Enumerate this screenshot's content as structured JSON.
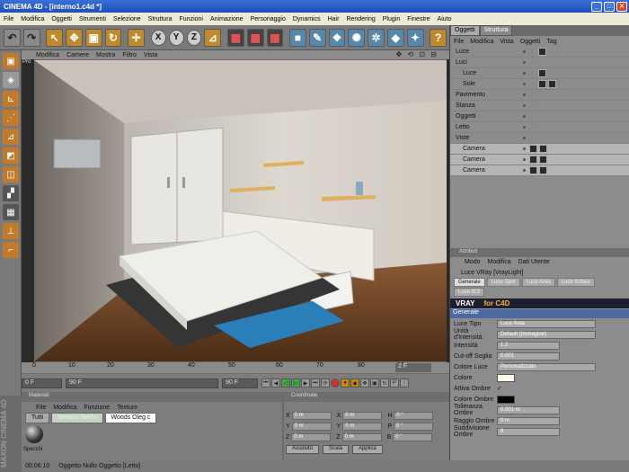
{
  "window": {
    "title": "CINEMA 4D - [interno1.c4d *]"
  },
  "menu": [
    "File",
    "Modifica",
    "Oggetti",
    "Strumenti",
    "Selezione",
    "Struttura",
    "Funzioni",
    "Animazione",
    "Personaggio",
    "Dynamics",
    "Hair",
    "Rendering",
    "Plugin",
    "Finestre",
    "Aiuto"
  ],
  "viewport": {
    "menu": [
      "Modifica",
      "Camere",
      "Mostra",
      "Filtro",
      "Vista"
    ],
    "label": "Pro",
    "nav": "✥ ⟲ ⊡ ⊟"
  },
  "timeline": {
    "ticks": [
      "0",
      "10",
      "20",
      "30",
      "40",
      "50",
      "60",
      "70",
      "80",
      "90"
    ],
    "frame": "2 F"
  },
  "playback": {
    "start": "0 F",
    "end": "90 F",
    "cur": "90 F"
  },
  "materials": {
    "header": "Materiali",
    "menu": [
      "File",
      "Modifica",
      "Funzione",
      "Texture"
    ],
    "tabs": [
      "Tutti",
      "Nessun livello",
      "Woods Oleg c"
    ],
    "item": "Specchi"
  },
  "coords": {
    "header": "Coordinate",
    "rows": [
      [
        "X",
        "0 m",
        "X",
        "0 m",
        "H",
        "0 °"
      ],
      [
        "Y",
        "0 m",
        "Y",
        "0 m",
        "P",
        "0 °"
      ],
      [
        "Z",
        "0 m",
        "Z",
        "0 m",
        "B",
        "0 °"
      ]
    ],
    "buttons": [
      "Assoluto",
      "Scala",
      "Applica"
    ]
  },
  "status": {
    "time": "00:06:10",
    "text": "Oggetto Nullo Oggetto [Letto]"
  },
  "maxon": "MAXON CINEMA 4D",
  "objects": {
    "tabs": [
      "Oggetti",
      "Struttura"
    ],
    "menu": [
      "File",
      "Modifica",
      "Vista",
      "Oggetti",
      "Tag"
    ],
    "items": [
      {
        "name": "Luce",
        "indent": 0
      },
      {
        "name": "Luci",
        "indent": 0
      },
      {
        "name": "Luce",
        "indent": 1
      },
      {
        "name": "Sole",
        "indent": 1
      },
      {
        "name": "Pavimento",
        "indent": 0
      },
      {
        "name": "Stanza",
        "indent": 0
      },
      {
        "name": "Oggetti",
        "indent": 0
      },
      {
        "name": "Letto",
        "indent": 0
      },
      {
        "name": "Viste",
        "indent": 0
      },
      {
        "name": "Camera",
        "indent": 1
      },
      {
        "name": "Camera",
        "indent": 1
      },
      {
        "name": "Camera",
        "indent": 1
      }
    ]
  },
  "attributes": {
    "header": "Attributi",
    "menu": [
      "Modo",
      "Modifica",
      "Dati Utente"
    ],
    "title": "Luce VRay [VrayLight]",
    "tabs": [
      "Generale",
      "Luce Spot",
      "Luce Area",
      "Luce Solare",
      "Luce IES"
    ],
    "vray": "VRAY",
    "vray2": "for C4D",
    "section": "Generale",
    "rows": [
      {
        "label": "Luce Tipo",
        "value": "Luce Area"
      },
      {
        "label": "Unità d'Intensità",
        "value": "Default (Immagine)"
      },
      {
        "label": "Intensità",
        "value": "1.2"
      },
      {
        "label": "Cut-off Soglia",
        "value": "0.001"
      },
      {
        "label": "Colore Luce",
        "value": "Personalizzato"
      },
      {
        "label": "Colore",
        "value": ""
      },
      {
        "label": "Attiva Ombre",
        "value": "✓"
      },
      {
        "label": "Colore Ombre",
        "value": ""
      },
      {
        "label": "Tolleranza Ombre",
        "value": "0.001 m"
      },
      {
        "label": "Raggio Ombre",
        "value": "0 m"
      },
      {
        "label": "Suddivisione Ombre",
        "value": "8"
      }
    ]
  }
}
